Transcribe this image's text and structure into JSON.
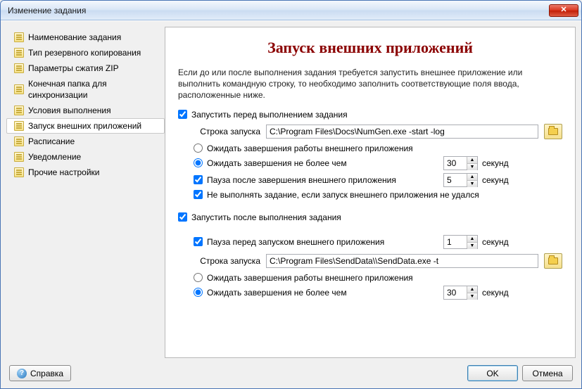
{
  "window": {
    "title": "Изменение задания"
  },
  "sidebar": {
    "items": [
      {
        "label": "Наименование задания"
      },
      {
        "label": "Тип резервного копирования"
      },
      {
        "label": "Параметры сжатия ZIP"
      },
      {
        "label": "Конечная папка для синхронизации"
      },
      {
        "label": "Условия выполнения"
      },
      {
        "label": "Запуск внешних приложений"
      },
      {
        "label": "Расписание"
      },
      {
        "label": "Уведомление"
      },
      {
        "label": "Прочие настройки"
      }
    ],
    "selected_index": 5
  },
  "content": {
    "title": "Запуск внешних приложений",
    "intro": "Если до или после выполнения задания требуется запустить внешнее приложение или выполнить командную строку, то необходимо заполнить соответствующие поля ввода, расположенные ниже.",
    "before": {
      "enable_label": "Запустить перед выполнением задания",
      "enable_checked": true,
      "cmd_label": "Строка запуска",
      "cmd_value": "C:\\Program Files\\Docs\\NumGen.exe -start -log",
      "wait_full_label": "Ожидать завершения работы внешнего приложения",
      "wait_limited_label": "Ожидать завершения не более чем",
      "wait_limited_selected": true,
      "wait_seconds": "30",
      "seconds_unit": "секунд",
      "pause_after_label": "Пауза после завершения внешнего приложения",
      "pause_after_checked": true,
      "pause_after_seconds": "5",
      "abort_on_fail_label": "Не выполнять задание, если запуск внешнего приложения не удался",
      "abort_on_fail_checked": true
    },
    "after": {
      "enable_label": "Запустить после выполнения задания",
      "enable_checked": true,
      "pause_before_label": "Пауза перед запуском внешнего приложения",
      "pause_before_checked": true,
      "pause_before_seconds": "1",
      "seconds_unit": "секунд",
      "cmd_label": "Строка запуска",
      "cmd_value": "C:\\Program Files\\SendData\\\\SendData.exe -t",
      "wait_full_label": "Ожидать завершения работы внешнего приложения",
      "wait_limited_label": "Ожидать завершения не более чем",
      "wait_limited_selected": true,
      "wait_seconds": "30"
    }
  },
  "footer": {
    "help": "Справка",
    "ok": "OK",
    "cancel": "Отмена"
  }
}
